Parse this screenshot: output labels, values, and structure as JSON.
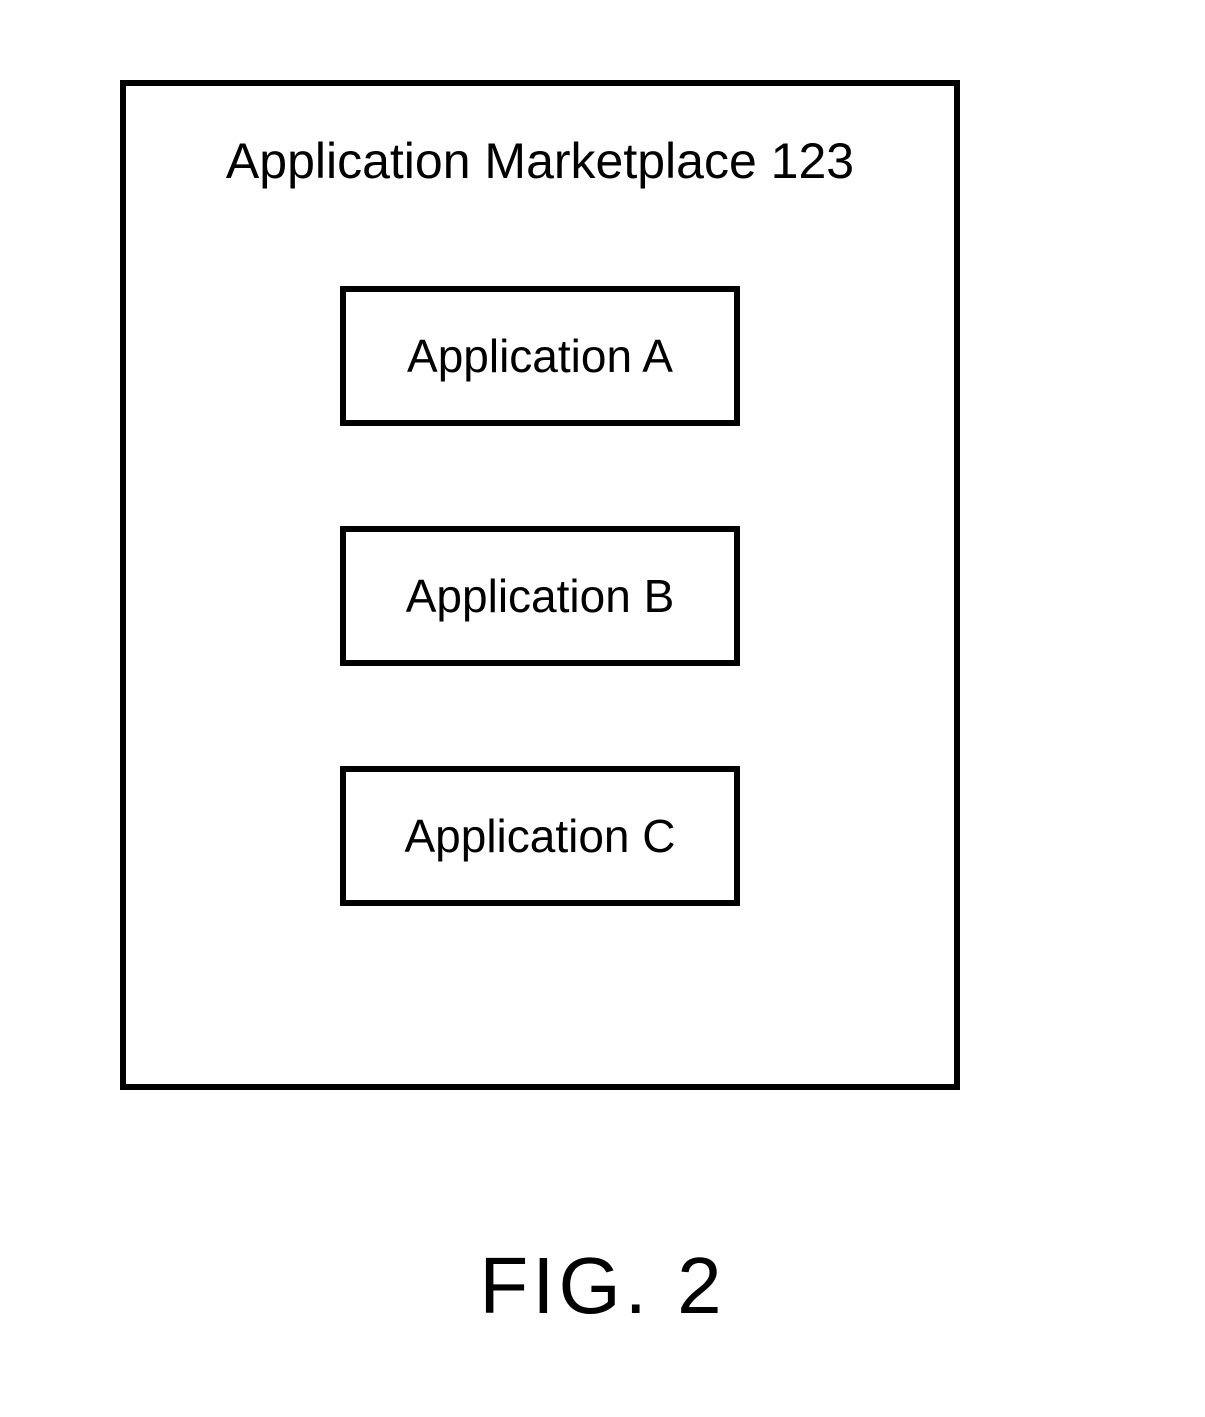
{
  "marketplace": {
    "title": "Application Marketplace 123",
    "apps": [
      {
        "label": "Application A"
      },
      {
        "label": "Application B"
      },
      {
        "label": "Application C"
      }
    ]
  },
  "caption": "FIG. 2"
}
